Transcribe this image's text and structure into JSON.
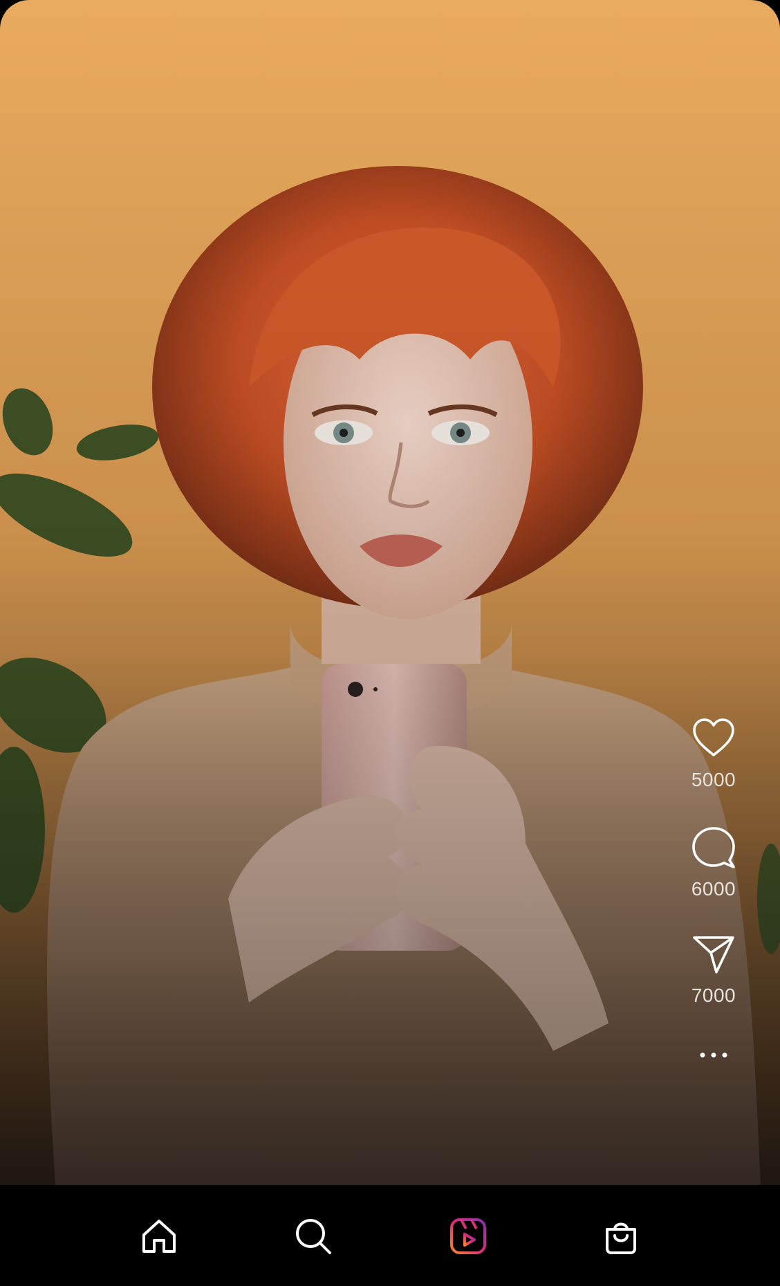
{
  "reel": {
    "media_description_hidden": true,
    "overlay_tint": "#000000"
  },
  "actions": {
    "like": {
      "icon": "heart-icon",
      "count": "5000"
    },
    "comment": {
      "icon": "comment-bubble-icon",
      "count": "6000"
    },
    "share": {
      "icon": "paper-plane-icon",
      "count": "7000"
    },
    "more": {
      "icon": "more-horizontal-icon"
    }
  },
  "navbar": {
    "items": [
      {
        "name": "home",
        "icon": "home-icon",
        "active": false
      },
      {
        "name": "search",
        "icon": "search-icon",
        "active": false
      },
      {
        "name": "reels",
        "icon": "reels-icon",
        "active": true
      },
      {
        "name": "shop",
        "icon": "shopping-bag-icon",
        "active": false
      }
    ],
    "active_gradient": [
      "#f58529",
      "#dd2a7b",
      "#8134af"
    ]
  },
  "colors": {
    "background_top": "#e8a95d",
    "background_mid": "#c98a49",
    "hair": "#d2582c",
    "sweater": "#b79573",
    "icon_color": "#ffffff",
    "count_color": "#e8e3df"
  }
}
